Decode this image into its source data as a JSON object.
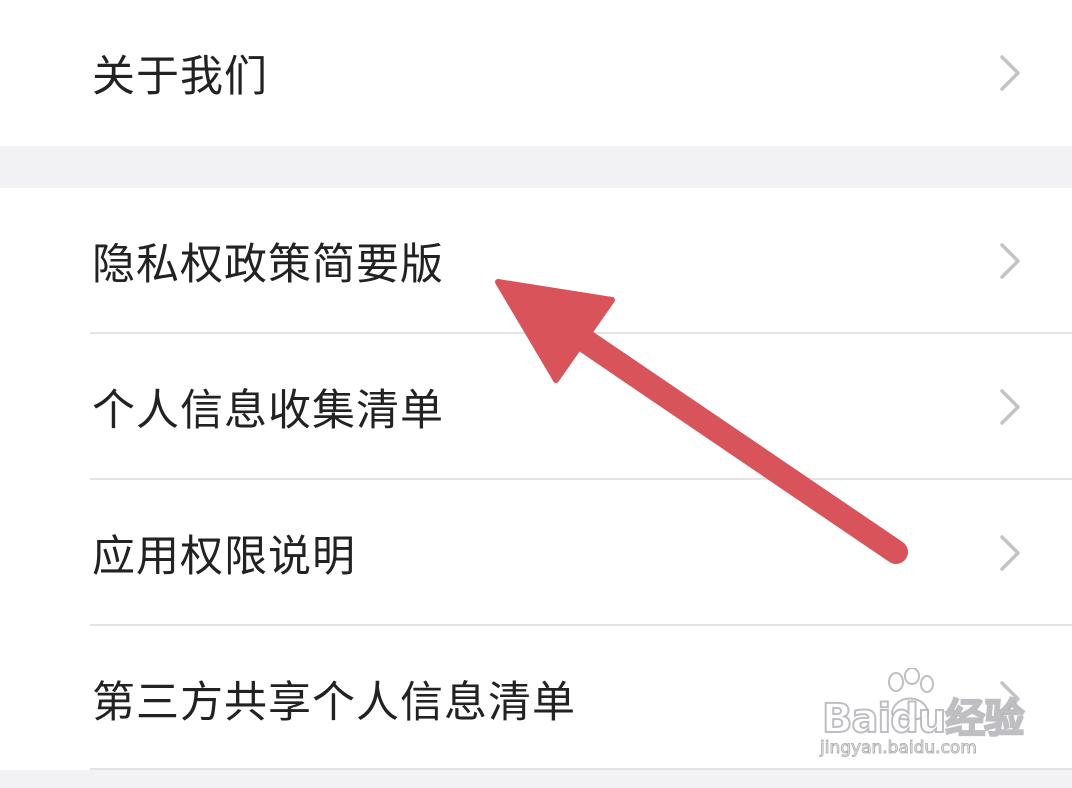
{
  "settings_list": {
    "top_section": [
      {
        "label": "关于我们"
      }
    ],
    "main_section": [
      {
        "label": "隐私权政策简要版"
      },
      {
        "label": "个人信息收集清单"
      },
      {
        "label": "应用权限说明"
      },
      {
        "label": "第三方共享个人信息清单"
      }
    ],
    "chevron_icon": "chevron-right-icon"
  },
  "annotation": {
    "arrow_color": "#d9535a",
    "arrow_target": "隐私权政策简要版"
  },
  "watermark": {
    "brand": "Baidu经验",
    "url": "jingyan.baidu.com"
  },
  "colors": {
    "background": "#f2f2f4",
    "row_background": "#ffffff",
    "text": "#222222",
    "divider": "#e4e4e6",
    "chevron": "#c4c4c8"
  }
}
